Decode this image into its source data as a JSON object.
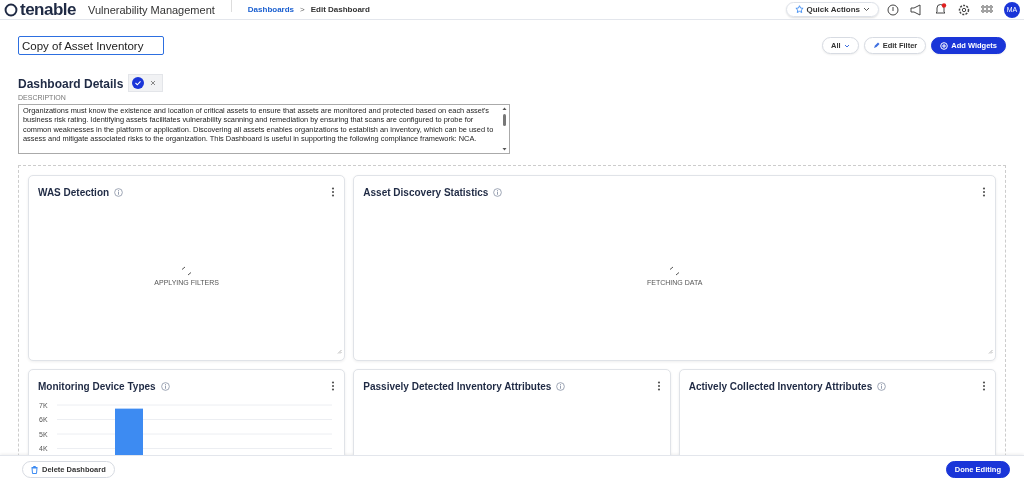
{
  "header": {
    "logo": "tenable",
    "product": "Vulnerability Management",
    "breadcrumbs": [
      {
        "label": "Dashboards",
        "kind": "link"
      },
      {
        "label": ">",
        "kind": "separator"
      },
      {
        "label": "Edit Dashboard",
        "kind": "current"
      }
    ],
    "quick_actions": "Quick Actions",
    "notification_badge": true,
    "avatar": "MA"
  },
  "title_field": {
    "value": "Copy of Asset Inventory"
  },
  "toolbar": {
    "filter": "All",
    "edit_filter": "Edit Filter",
    "add_widgets": "Add Widgets"
  },
  "details": {
    "heading": "Dashboard Details",
    "description_label": "DESCRIPTION",
    "description": "Organizations must know the existence and location of critical assets to ensure that assets are monitored and protected based on each asset's business risk rating. Identifying assets facilitates vulnerability scanning and remediation by ensuring that scans are configured to probe for common weaknesses in the platform or application. Discovering all assets enables organizations to establish an inventory, which can be used to assess and mitigate associated risks to the organization. This Dashboard is useful in supporting the following compliance framework: NCA."
  },
  "widgets": [
    {
      "title": "WAS Detection",
      "kind": "loading",
      "status": "APPLYING FILTERS"
    },
    {
      "title": "Asset Discovery Statistics",
      "kind": "loading",
      "status": "FETCHING DATA"
    },
    {
      "title": "Monitoring Device Types",
      "kind": "chart",
      "chart_data": {
        "type": "bar",
        "values": [
          6750
        ],
        "ylim": [
          4000,
          7000
        ],
        "yticks": [
          {
            "value": 7000,
            "label": "7K"
          },
          {
            "value": 6000,
            "label": "6K"
          },
          {
            "value": 5000,
            "label": "5K"
          },
          {
            "value": 4000,
            "label": "4K"
          }
        ]
      }
    },
    {
      "title": "Passively Detected Inventory Attributes",
      "kind": "empty"
    },
    {
      "title": "Actively Collected Inventory Attributes",
      "kind": "empty"
    }
  ],
  "footer": {
    "delete": "Delete Dashboard",
    "done": "Done Editing"
  }
}
